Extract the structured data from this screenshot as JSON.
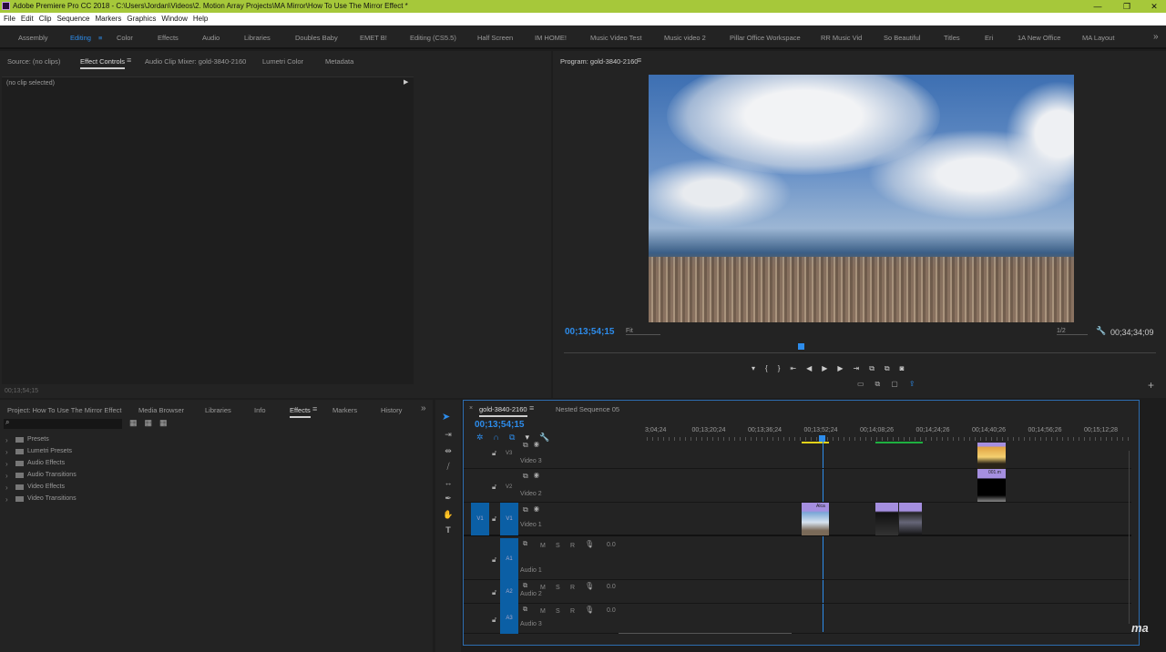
{
  "window": {
    "title": "Adobe Premiere Pro CC 2018 - C:\\Users\\Jordan\\Videos\\2. Motion Array Projects\\MA Mirror\\How To Use The Mirror Effect *",
    "minimize": "—",
    "maximize": "❐",
    "close": "✕"
  },
  "menu": [
    "File",
    "Edit",
    "Clip",
    "Sequence",
    "Markers",
    "Graphics",
    "Window",
    "Help"
  ],
  "workspaces": [
    "Assembly",
    "Editing",
    "Color",
    "Effects",
    "Audio",
    "Libraries",
    "Doubles Baby",
    "EMET B!",
    "Editing (CS5.5)",
    "Half Screen",
    "IM HOME!",
    "Music Video Test",
    "Music video 2",
    "Pillar Office Workspace",
    "RR Music Vid",
    "So Beautiful",
    "Titles",
    "Eri",
    "1A New Office",
    "MA Layout"
  ],
  "workspaces_more": "»",
  "source_panel": {
    "tabs": [
      "Source: (no clips)",
      "Effect Controls",
      "Audio Clip Mixer: gold-3840-2160",
      "Lumetri Color",
      "Metadata"
    ],
    "no_clip": "(no clip selected)",
    "timecode": "00;13;54;15"
  },
  "program": {
    "title": "Program: gold-3840-2160",
    "timecode_current": "00;13;54;15",
    "fit": "Fit",
    "resolution": "1/2",
    "timecode_duration": "00;34;34;09"
  },
  "project_panel": {
    "tabs": [
      "Project: How To Use The Mirror Effect",
      "Media Browser",
      "Libraries",
      "Info",
      "Effects",
      "Markers",
      "History"
    ],
    "more": "»",
    "search_placeholder": "",
    "folders": [
      "Presets",
      "Lumetri Presets",
      "Audio Effects",
      "Audio Transitions",
      "Video Effects",
      "Video Transitions"
    ]
  },
  "timeline": {
    "tabs": [
      "gold-3840-2160",
      "Nested Sequence 05"
    ],
    "close": "×",
    "timecode": "00;13;54;15",
    "ruler": [
      "3;04;24",
      "00;13;20;24",
      "00;13;36;24",
      "00;13;52;24",
      "00;14;08;26",
      "00;14;24;26",
      "00;14;40;26",
      "00;14;56;26",
      "00;15;12;28"
    ],
    "video_tracks": [
      {
        "id": "V3",
        "name": "Video 3"
      },
      {
        "id": "V2",
        "name": "Video 2"
      },
      {
        "id": "V1",
        "name": "Video 1",
        "source": "V1"
      }
    ],
    "audio_tracks": [
      {
        "id": "A1",
        "name": "Audio 1",
        "level": "0.0"
      },
      {
        "id": "A2",
        "name": "Audio 2",
        "level": "0.0"
      },
      {
        "id": "A3",
        "name": "Audio 3",
        "level": "0.0"
      }
    ],
    "clip_labels": {
      "v1a": "Alca",
      "v2": "001.m",
      "mute": "M",
      "solo": "S",
      "record": "R"
    }
  },
  "watermark": "ma",
  "colors": {
    "accent": "#2d8ceb",
    "titlebar": "#a6c83a",
    "clip": "#a58fe0",
    "track_target": "#0b5fa5"
  }
}
